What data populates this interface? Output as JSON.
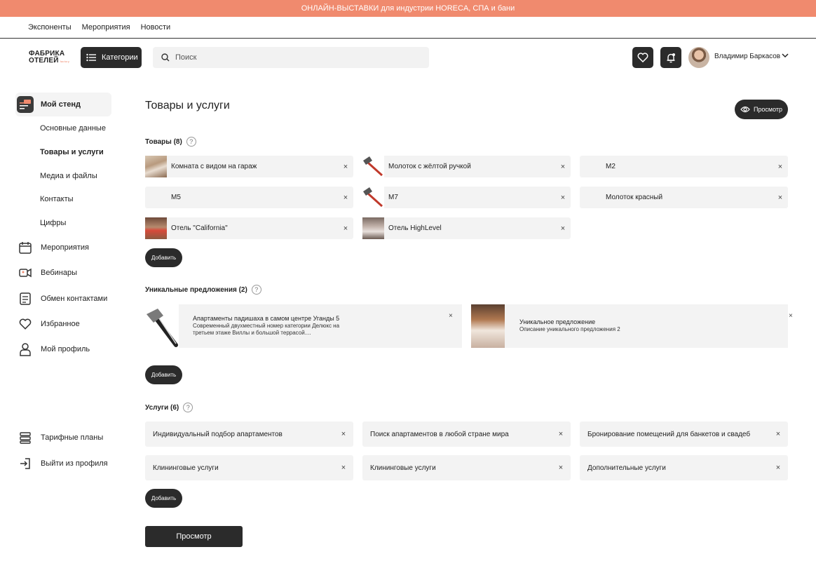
{
  "banner": "ОНЛАЙН-ВЫСТАВКИ для индустрии HORECA, СПА и бани",
  "topnav": [
    "Экспоненты",
    "Мероприятия",
    "Новости"
  ],
  "header": {
    "logo_line1": "ФАБРИКА",
    "logo_line2": "ОТЕЛЕЙ",
    "logo_sub": "factory",
    "categories_label": "Категории",
    "search_placeholder": "Поиск",
    "user_name": "Владимир Баркасов"
  },
  "sidebar": {
    "my_stand": "Мой стенд",
    "sub_items": [
      "Основные данные",
      "Товары и услуги",
      "Медиа и файлы",
      "Контакты",
      "Цифры"
    ],
    "items": [
      "Мероприятия",
      "Вебинары",
      "Обмен контактами",
      "Избранное",
      "Мой профиль"
    ],
    "bottom": [
      "Тарифные планы",
      "Выйти из профиля"
    ]
  },
  "main": {
    "title": "Товары и услуги",
    "preview_pill": "Просмотр",
    "goods_title": "Товары (8)",
    "goods": [
      {
        "label": "Комната с видом на гараж",
        "thumb": "room"
      },
      {
        "label": "Молоток с жёлтой ручкой",
        "thumb": "hammer"
      },
      {
        "label": "М2",
        "thumb": ""
      },
      {
        "label": "М5",
        "thumb": ""
      },
      {
        "label": "М7",
        "thumb": "hammer"
      },
      {
        "label": "Молоток красный",
        "thumb": ""
      },
      {
        "label": "Отель \"California\"",
        "thumb": "hotel1"
      },
      {
        "label": "Отель HighLevel",
        "thumb": "hotel2"
      }
    ],
    "add_label": "Добавить",
    "offers_title": "Уникальные предложения (2)",
    "offers": [
      {
        "title": "Апартаменты падишаха в самом центре Уганды 5",
        "desc": "Современный двухместный номер категории Делюкс на третьем этаже Виллы и большой террасой...."
      },
      {
        "title": "Уникальное предложение",
        "desc": "Описание уникального предложения 2"
      }
    ],
    "services_title": "Услуги (6)",
    "services": [
      "Индивидуальный подбор апартаментов",
      "Поиск апартаментов в любой стране мира",
      "Бронирование помещений для банкетов и свадеб",
      "Клининговые услуги",
      "Клининговые услуги",
      "Дополнительные услуги"
    ],
    "preview_button": "Просмотр",
    "remove_symbol": "×"
  }
}
